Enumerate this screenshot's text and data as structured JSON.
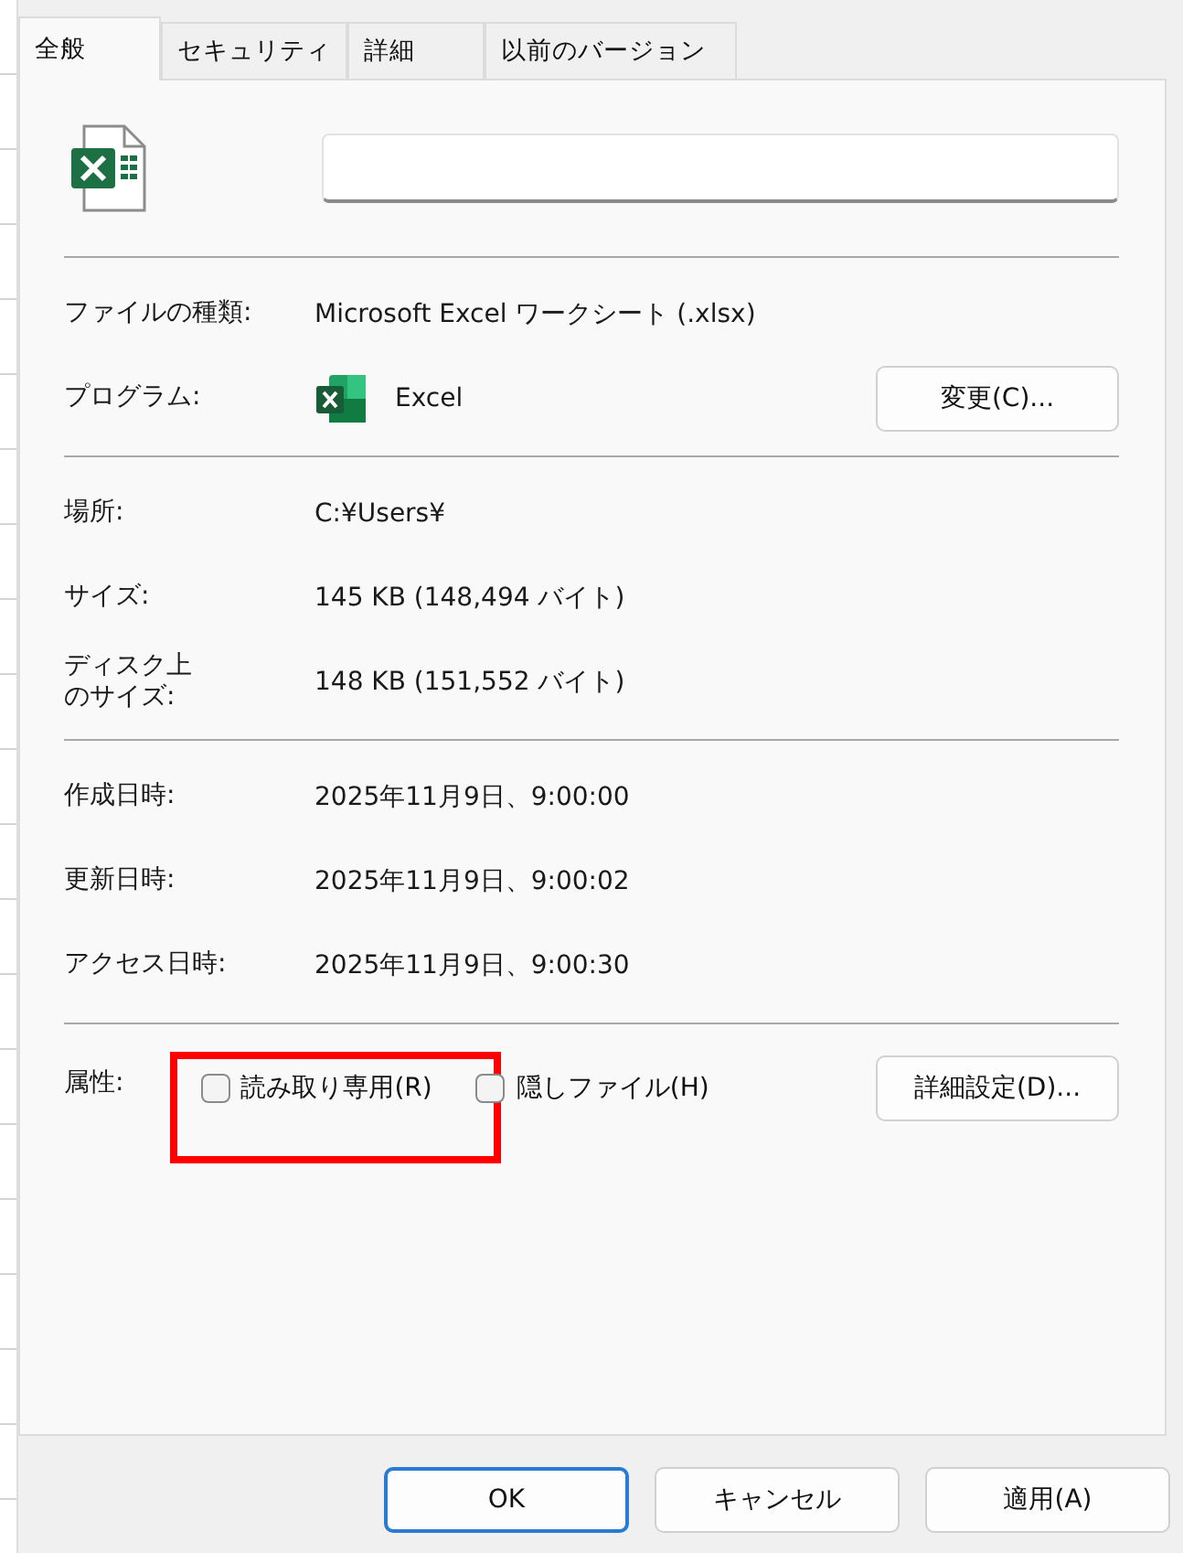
{
  "tabs": [
    {
      "label": "全般",
      "selected": true
    },
    {
      "label": "セキュリティ",
      "selected": false
    },
    {
      "label": "詳細",
      "selected": false
    },
    {
      "label": "以前のバージョン",
      "selected": false
    }
  ],
  "sections": [
    [
      {
        "kind": "text",
        "label": "ファイルの種類:",
        "value": "Microsoft Excel ワークシート (.xlsx)"
      },
      {
        "kind": "program",
        "label": "プログラム:",
        "value": "Excel",
        "button": "変更(C)..."
      }
    ],
    [
      {
        "kind": "text",
        "label": "場所:",
        "value": "C:¥Users¥"
      },
      {
        "kind": "text",
        "label": "サイズ:",
        "value": "145 KB (148,494 バイト)"
      },
      {
        "kind": "wrapped",
        "label": "ディスク上のサイズ:",
        "value": "148 KB (151,552 バイト)"
      }
    ],
    [
      {
        "kind": "text",
        "label": "作成日時:",
        "value": "2025年11月9日、9:00:00"
      },
      {
        "kind": "text",
        "label": "更新日時:",
        "value": "2025年11月9日、9:00:02"
      },
      {
        "kind": "text",
        "label": "アクセス日時:",
        "value": "2025年11月9日、9:00:30"
      }
    ]
  ],
  "attributes": {
    "label": "属性:",
    "checkboxes": [
      {
        "label": "読み取り専用(R)",
        "checked": false,
        "highlighted": true
      },
      {
        "label": "隠しファイル(H)",
        "checked": false,
        "highlighted": false
      }
    ],
    "button": "詳細設定(D)..."
  },
  "buttons": [
    {
      "label": "OK",
      "default": true
    },
    {
      "label": "キャンセル",
      "default": false
    },
    {
      "label": "適用(A)",
      "default": false
    }
  ]
}
